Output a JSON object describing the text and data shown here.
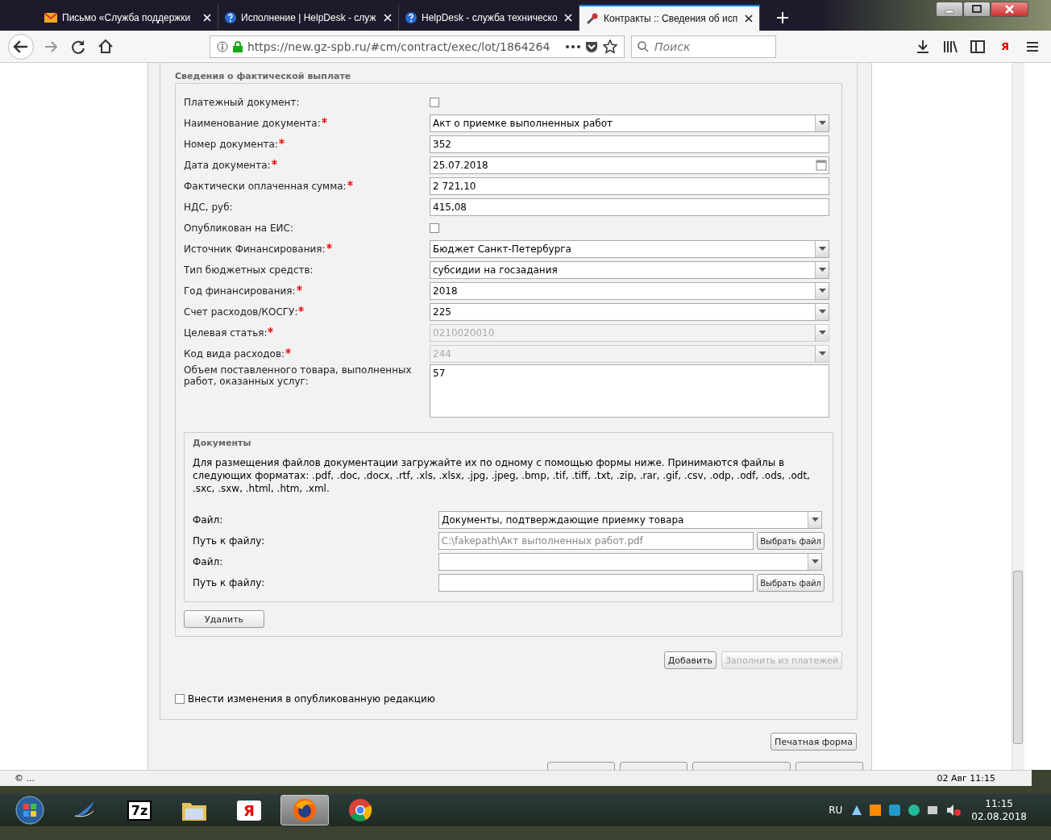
{
  "browser": {
    "tabs": [
      {
        "title": "Письмо «Служба поддержки",
        "selected": false
      },
      {
        "title": "Исполнение | HelpDesk - служ",
        "selected": false
      },
      {
        "title": "HelpDesk - служба техническо",
        "selected": false
      },
      {
        "title": "Контракты :: Сведения об исп",
        "selected": true
      }
    ],
    "url": "https://new.gz-spb.ru/#cm/contract/exec/lot/1864264",
    "search": {
      "placeholder": "Поиск"
    },
    "yandex_label": "Я"
  },
  "section": {
    "title": "Сведения о фактической выплате",
    "fields": [
      {
        "label": "Платежный документ:",
        "kind": "checkbox",
        "required": false,
        "checked": false
      },
      {
        "label": "Наименование документа:",
        "kind": "select",
        "required": true,
        "value": "Акт о приемке выполненных работ",
        "disabled": false
      },
      {
        "label": "Номер документа:",
        "kind": "input",
        "required": true,
        "value": "352"
      },
      {
        "label": "Дата документа:",
        "kind": "date",
        "required": true,
        "value": "25.07.2018"
      },
      {
        "label": "Фактически оплаченная сумма:",
        "kind": "input",
        "required": true,
        "value": "2 721,10"
      },
      {
        "label": "НДС, руб:",
        "kind": "input",
        "required": false,
        "value": "415,08"
      },
      {
        "label": "Опубликован на ЕИС:",
        "kind": "checkbox",
        "required": false,
        "checked": false
      },
      {
        "label": "Источник Финансирования:",
        "kind": "select",
        "required": true,
        "value": "Бюджет Санкт-Петербурга",
        "disabled": false
      },
      {
        "label": "Тип бюджетных средств:",
        "kind": "select",
        "required": false,
        "value": "субсидии на госзадания",
        "disabled": false
      },
      {
        "label": "Год финансирования:",
        "kind": "select",
        "required": true,
        "value": "2018",
        "disabled": false
      },
      {
        "label": "Счет расходов/КОСГУ:",
        "kind": "select",
        "required": true,
        "value": "225",
        "disabled": false
      },
      {
        "label": "Целевая статья:",
        "kind": "select",
        "required": true,
        "value": "0210020010",
        "disabled": true
      },
      {
        "label": "Код вида расходов:",
        "kind": "select",
        "required": true,
        "value": "244",
        "disabled": true
      },
      {
        "label": "Объем поставленного товара, выполненных работ, оказанных услуг:",
        "kind": "textarea",
        "required": false,
        "value": "57"
      }
    ],
    "documents": {
      "title": "Документы",
      "note": "Для размещения файлов документации загружайте их по одному с помощью формы ниже. Принимаются файлы в следующих форматах: .pdf, .doc, .docx, .rtf, .xls, .xlsx, .jpg, .jpeg, .bmp, .tif, .tiff, .txt, .zip, .rar, .gif, .csv, .odp, .odf, .ods, .odt, .sxc, .sxw, .html, .htm, .xml.",
      "files": [
        {
          "file_label": "Файл:",
          "file_type": "Документы, подтверждающие приемку товара",
          "path_label": "Путь к файлу:",
          "path": "C:\\fakepath\\Акт выполненных работ.pdf",
          "browse": "Выбрать файл"
        },
        {
          "file_label": "Файл:",
          "path_label": "Путь к файлу:",
          "browse": "Выбрать файл"
        }
      ],
      "delete_button": "Удалить"
    },
    "buttons": [
      {
        "label": "Добавить",
        "disabled": false
      },
      {
        "label": "Заполнить из платежей",
        "disabled": true
      }
    ]
  },
  "publish_changes": {
    "label": "Внести изменения в опубликованную редакцию",
    "checked": false
  },
  "print_button": "Печатная форма",
  "status_bar": {
    "left": "© ...",
    "right": "02 Авг 11:15"
  },
  "taskbar": {
    "apps": [
      {
        "selected": false
      },
      {
        "selected": false
      },
      {
        "label": "7z",
        "selected": false
      },
      {
        "selected": false
      },
      {
        "label": "Я",
        "selected": false
      },
      {
        "selected": true
      },
      {
        "selected": false
      }
    ],
    "language": "RU",
    "time": "11:15",
    "date": "02.08.2018"
  }
}
